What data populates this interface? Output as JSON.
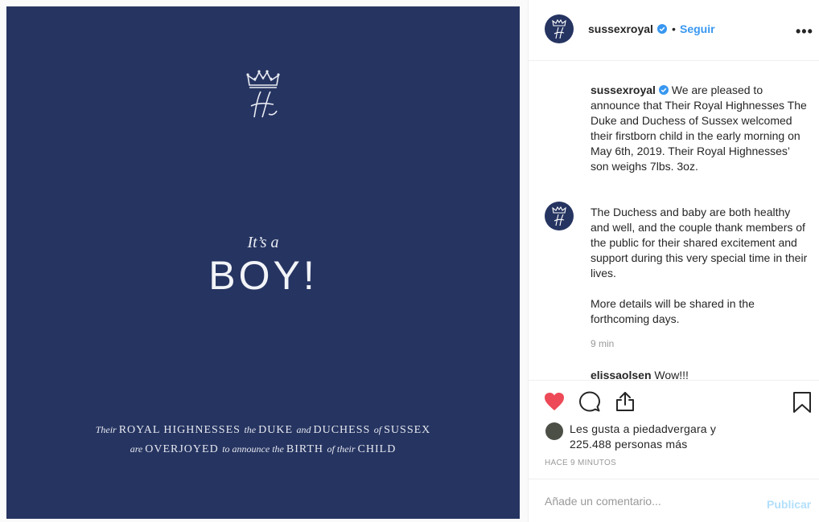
{
  "post": {
    "image": {
      "its_a": "It’s a",
      "boy": "BOY!",
      "line1": [
        {
          "t": "Their ",
          "small": true
        },
        {
          "t": "ROYAL HIGHNESSES ",
          "small": false
        },
        {
          "t": "the ",
          "small": true
        },
        {
          "t": "DUKE ",
          "small": false
        },
        {
          "t": "and ",
          "small": true
        },
        {
          "t": "DUCHESS ",
          "small": false
        },
        {
          "t": "of ",
          "small": true
        },
        {
          "t": "SUSSEX",
          "small": false
        }
      ],
      "line2": [
        {
          "t": "are ",
          "small": true
        },
        {
          "t": "OVERJOYED ",
          "small": false
        },
        {
          "t": "to announce the ",
          "small": true
        },
        {
          "t": "BIRTH ",
          "small": false
        },
        {
          "t": "of their ",
          "small": true
        },
        {
          "t": "CHILD",
          "small": false
        }
      ],
      "monogram_icon": "crowned-H-monogram",
      "background": "#263461"
    }
  },
  "header": {
    "username": "sussexroyal",
    "separator": "•",
    "follow_label": "Seguir",
    "more_label": "•••"
  },
  "comments": {
    "caption_user": "sussexroyal",
    "caption_text": " We are pleased to announce that Their Royal Highnesses The Duke and Duchess of Sussex welcomed their firstborn child in the early morning on May 6th, 2019. Their Royal Highnesses’ son weighs 7lbs. 3oz.",
    "second_text": "The Duchess and baby are both healthy and well, and the couple thank members of the public for their shared excitement and support during this very special time in their lives.",
    "third_text": "More details will be shared in the forthcoming days.",
    "time": "9 min",
    "next_user": "elissaolsen",
    "next_text": "Wow!!!"
  },
  "actions": {
    "likes_prefix": "Les gusta a ",
    "likes_user": "piedadvergara",
    "likes_suffix": " y",
    "likes_count": "225.488 personas más",
    "time_ago": "HACE 9 MINUTOS"
  },
  "add_comment": {
    "placeholder": "Añade un comentario...",
    "publish_label": "Publicar"
  },
  "colors": {
    "accent": "#3897f0",
    "heart": "#ed4956",
    "publish_disabled": "#b2dffc"
  }
}
